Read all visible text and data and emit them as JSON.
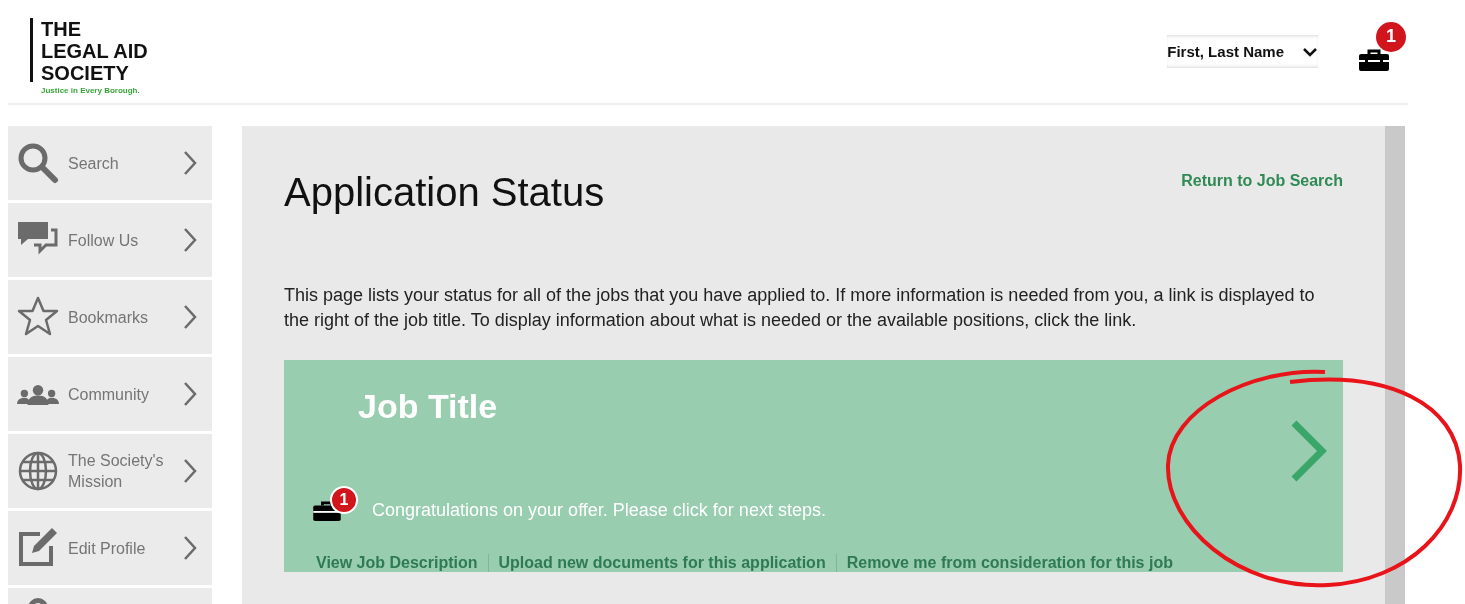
{
  "logo": {
    "lines": [
      "THE",
      "LEGAL AID",
      "SOCIETY"
    ],
    "tagline": "Justice in Every Borough."
  },
  "user_menu": {
    "name": "First, Last Name"
  },
  "jobs_cart": {
    "badge": "1"
  },
  "sidebar": {
    "items": [
      {
        "label": "Search"
      },
      {
        "label": "Follow Us"
      },
      {
        "label": "Bookmarks"
      },
      {
        "label": "Community"
      },
      {
        "label": "The Society's Mission"
      },
      {
        "label": "Edit Profile"
      }
    ]
  },
  "main": {
    "title": "Application Status",
    "return_link": "Return to Job Search",
    "intro": "This page lists your status for all of the jobs that you have applied to. If more information is needed from you, a link is displayed to the right of the job title. To display information about what is needed or the available positions, click the link.",
    "application": {
      "job_title": "Job Title",
      "badge": "1",
      "message": "Congratulations on your offer. Please click for next steps.",
      "links": [
        "View Job Description",
        "Upload new documents for this application",
        "Remove me from consideration for this job"
      ]
    }
  }
}
